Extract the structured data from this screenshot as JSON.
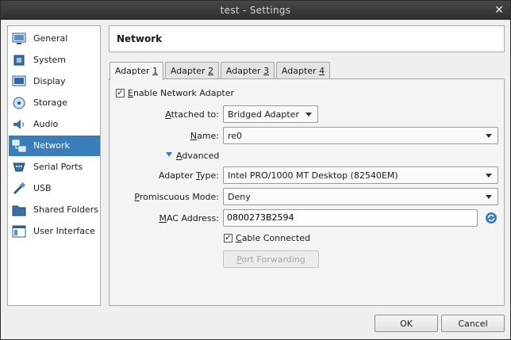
{
  "window": {
    "title": "test - Settings"
  },
  "sidebar": {
    "items": [
      {
        "label": "General",
        "icon": "monitor-icon"
      },
      {
        "label": "System",
        "icon": "chip-icon"
      },
      {
        "label": "Display",
        "icon": "display-icon"
      },
      {
        "label": "Storage",
        "icon": "disk-icon"
      },
      {
        "label": "Audio",
        "icon": "speaker-icon"
      },
      {
        "label": "Network",
        "icon": "network-icon",
        "selected": true
      },
      {
        "label": "Serial Ports",
        "icon": "serial-port-icon"
      },
      {
        "label": "USB",
        "icon": "usb-icon"
      },
      {
        "label": "Shared Folders",
        "icon": "folder-icon"
      },
      {
        "label": "User Interface",
        "icon": "window-icon"
      }
    ]
  },
  "header": {
    "title": "Network"
  },
  "tabs": [
    {
      "label": "Adapter 1",
      "prefix": "Adapter ",
      "key": "1",
      "active": true
    },
    {
      "label": "Adapter 2",
      "prefix": "Adapter ",
      "key": "2"
    },
    {
      "label": "Adapter 3",
      "prefix": "Adapter ",
      "key": "3"
    },
    {
      "label": "Adapter 4",
      "prefix": "Adapter ",
      "key": "4"
    }
  ],
  "adapter": {
    "enable": {
      "label": "Enable Network Adapter",
      "checked": true,
      "key": "E",
      "rest": "nable Network Adapter"
    },
    "attached_to": {
      "label": "Attached to:",
      "key": "A",
      "rest": "ttached to:",
      "value": "Bridged Adapter"
    },
    "name": {
      "label": "Name:",
      "key": "N",
      "rest": "ame:",
      "value": "re0"
    },
    "advanced": {
      "label": "Advanced",
      "key": "A",
      "rest": "dvanced",
      "expanded": true
    },
    "adapter_type": {
      "label": "Adapter Type:",
      "pre": "Adapter ",
      "key": "T",
      "rest": "ype:",
      "value": "Intel PRO/1000 MT Desktop (82540EM)"
    },
    "promiscuous": {
      "label": "Promiscuous Mode:",
      "key": "P",
      "rest": "romiscuous Mode:",
      "value": "Deny"
    },
    "mac": {
      "label": "MAC Address:",
      "key": "M",
      "rest": "AC Address:",
      "value": "0800273B2594"
    },
    "cable": {
      "label": "Cable Connected",
      "key": "C",
      "rest": "able Connected",
      "checked": true
    },
    "port_forwarding": {
      "label": "Port Forwarding",
      "key": "P",
      "rest": "ort Forwarding"
    }
  },
  "buttons": {
    "ok": "OK",
    "cancel": "Cancel"
  },
  "colors": {
    "selection": "#3a7dbb",
    "titlebar": "#3a3a3a"
  }
}
